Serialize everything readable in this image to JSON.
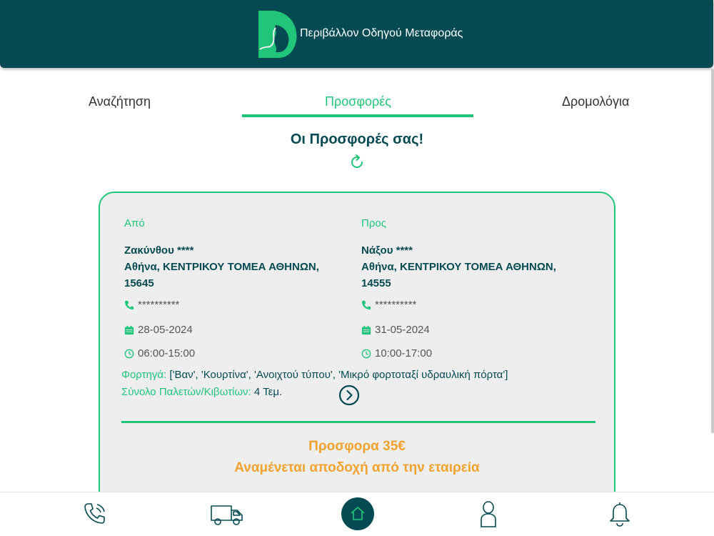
{
  "header": {
    "title": "Περιβάλλον Οδηγού Μεταφοράς",
    "background_color": "#044a53",
    "logo_colors": [
      "#21c57a",
      "#044a53"
    ]
  },
  "tabs": [
    {
      "label": "Αναζήτηση",
      "active": false
    },
    {
      "label": "Προσφορές",
      "active": true
    },
    {
      "label": "Δρομολόγια",
      "active": false
    }
  ],
  "section_title": "Οι Προσφορές σας!",
  "offer": {
    "from": {
      "label": "Από",
      "name": "Ζακύνθου ****",
      "address": "Αθήνα, ΚΕΝΤΡΙΚΟΥ ΤΟΜΕΑ ΑΘΗΝΩΝ, 15645",
      "phone": "**********",
      "date": "28-05-2024",
      "time": "06:00-15:00"
    },
    "to": {
      "label": "Προς",
      "name": "Νάξου ****",
      "address": "Αθήνα, ΚΕΝΤΡΙΚΟΥ ΤΟΜΕΑ ΑΘΗΝΩΝ, 14555",
      "phone": "**********",
      "date": "31-05-2024",
      "time": "10:00-17:00"
    },
    "cargo_label": "Φορτηγά:",
    "cargo_value": "['Βαν', 'Κουρτίνα', 'Ανοιχτού τύπου', 'Μικρό φορτοταξί υδραυλική πόρτα']",
    "pallets_label": "Σύνολο Παλετών/Κιβωτίων:",
    "pallets_value": "4 Τεμ.",
    "price": "Προσφορα 35€",
    "status": "Αναμένεται αποδοχή από την εταιρεία"
  },
  "bottom_nav": [
    {
      "icon": "phone-call-icon"
    },
    {
      "icon": "truck-icon"
    },
    {
      "icon": "home-icon",
      "active": true
    },
    {
      "icon": "user-icon"
    },
    {
      "icon": "bell-icon"
    }
  ],
  "colors": {
    "accent": "#21c57a",
    "primary": "#044a53",
    "offer_text": "#f0a330",
    "card_background": "#eeeeee"
  }
}
